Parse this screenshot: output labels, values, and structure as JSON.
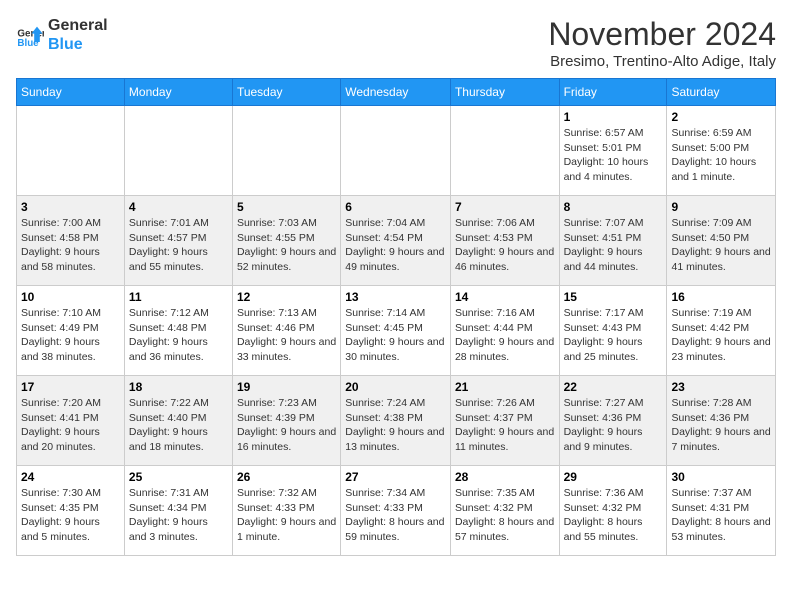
{
  "logo": {
    "text_general": "General",
    "text_blue": "Blue"
  },
  "header": {
    "month_title": "November 2024",
    "subtitle": "Bresimo, Trentino-Alto Adige, Italy"
  },
  "days_of_week": [
    "Sunday",
    "Monday",
    "Tuesday",
    "Wednesday",
    "Thursday",
    "Friday",
    "Saturday"
  ],
  "weeks": [
    [
      {
        "day": "",
        "info": ""
      },
      {
        "day": "",
        "info": ""
      },
      {
        "day": "",
        "info": ""
      },
      {
        "day": "",
        "info": ""
      },
      {
        "day": "",
        "info": ""
      },
      {
        "day": "1",
        "info": "Sunrise: 6:57 AM\nSunset: 5:01 PM\nDaylight: 10 hours and 4 minutes."
      },
      {
        "day": "2",
        "info": "Sunrise: 6:59 AM\nSunset: 5:00 PM\nDaylight: 10 hours and 1 minute."
      }
    ],
    [
      {
        "day": "3",
        "info": "Sunrise: 7:00 AM\nSunset: 4:58 PM\nDaylight: 9 hours and 58 minutes."
      },
      {
        "day": "4",
        "info": "Sunrise: 7:01 AM\nSunset: 4:57 PM\nDaylight: 9 hours and 55 minutes."
      },
      {
        "day": "5",
        "info": "Sunrise: 7:03 AM\nSunset: 4:55 PM\nDaylight: 9 hours and 52 minutes."
      },
      {
        "day": "6",
        "info": "Sunrise: 7:04 AM\nSunset: 4:54 PM\nDaylight: 9 hours and 49 minutes."
      },
      {
        "day": "7",
        "info": "Sunrise: 7:06 AM\nSunset: 4:53 PM\nDaylight: 9 hours and 46 minutes."
      },
      {
        "day": "8",
        "info": "Sunrise: 7:07 AM\nSunset: 4:51 PM\nDaylight: 9 hours and 44 minutes."
      },
      {
        "day": "9",
        "info": "Sunrise: 7:09 AM\nSunset: 4:50 PM\nDaylight: 9 hours and 41 minutes."
      }
    ],
    [
      {
        "day": "10",
        "info": "Sunrise: 7:10 AM\nSunset: 4:49 PM\nDaylight: 9 hours and 38 minutes."
      },
      {
        "day": "11",
        "info": "Sunrise: 7:12 AM\nSunset: 4:48 PM\nDaylight: 9 hours and 36 minutes."
      },
      {
        "day": "12",
        "info": "Sunrise: 7:13 AM\nSunset: 4:46 PM\nDaylight: 9 hours and 33 minutes."
      },
      {
        "day": "13",
        "info": "Sunrise: 7:14 AM\nSunset: 4:45 PM\nDaylight: 9 hours and 30 minutes."
      },
      {
        "day": "14",
        "info": "Sunrise: 7:16 AM\nSunset: 4:44 PM\nDaylight: 9 hours and 28 minutes."
      },
      {
        "day": "15",
        "info": "Sunrise: 7:17 AM\nSunset: 4:43 PM\nDaylight: 9 hours and 25 minutes."
      },
      {
        "day": "16",
        "info": "Sunrise: 7:19 AM\nSunset: 4:42 PM\nDaylight: 9 hours and 23 minutes."
      }
    ],
    [
      {
        "day": "17",
        "info": "Sunrise: 7:20 AM\nSunset: 4:41 PM\nDaylight: 9 hours and 20 minutes."
      },
      {
        "day": "18",
        "info": "Sunrise: 7:22 AM\nSunset: 4:40 PM\nDaylight: 9 hours and 18 minutes."
      },
      {
        "day": "19",
        "info": "Sunrise: 7:23 AM\nSunset: 4:39 PM\nDaylight: 9 hours and 16 minutes."
      },
      {
        "day": "20",
        "info": "Sunrise: 7:24 AM\nSunset: 4:38 PM\nDaylight: 9 hours and 13 minutes."
      },
      {
        "day": "21",
        "info": "Sunrise: 7:26 AM\nSunset: 4:37 PM\nDaylight: 9 hours and 11 minutes."
      },
      {
        "day": "22",
        "info": "Sunrise: 7:27 AM\nSunset: 4:36 PM\nDaylight: 9 hours and 9 minutes."
      },
      {
        "day": "23",
        "info": "Sunrise: 7:28 AM\nSunset: 4:36 PM\nDaylight: 9 hours and 7 minutes."
      }
    ],
    [
      {
        "day": "24",
        "info": "Sunrise: 7:30 AM\nSunset: 4:35 PM\nDaylight: 9 hours and 5 minutes."
      },
      {
        "day": "25",
        "info": "Sunrise: 7:31 AM\nSunset: 4:34 PM\nDaylight: 9 hours and 3 minutes."
      },
      {
        "day": "26",
        "info": "Sunrise: 7:32 AM\nSunset: 4:33 PM\nDaylight: 9 hours and 1 minute."
      },
      {
        "day": "27",
        "info": "Sunrise: 7:34 AM\nSunset: 4:33 PM\nDaylight: 8 hours and 59 minutes."
      },
      {
        "day": "28",
        "info": "Sunrise: 7:35 AM\nSunset: 4:32 PM\nDaylight: 8 hours and 57 minutes."
      },
      {
        "day": "29",
        "info": "Sunrise: 7:36 AM\nSunset: 4:32 PM\nDaylight: 8 hours and 55 minutes."
      },
      {
        "day": "30",
        "info": "Sunrise: 7:37 AM\nSunset: 4:31 PM\nDaylight: 8 hours and 53 minutes."
      }
    ]
  ]
}
